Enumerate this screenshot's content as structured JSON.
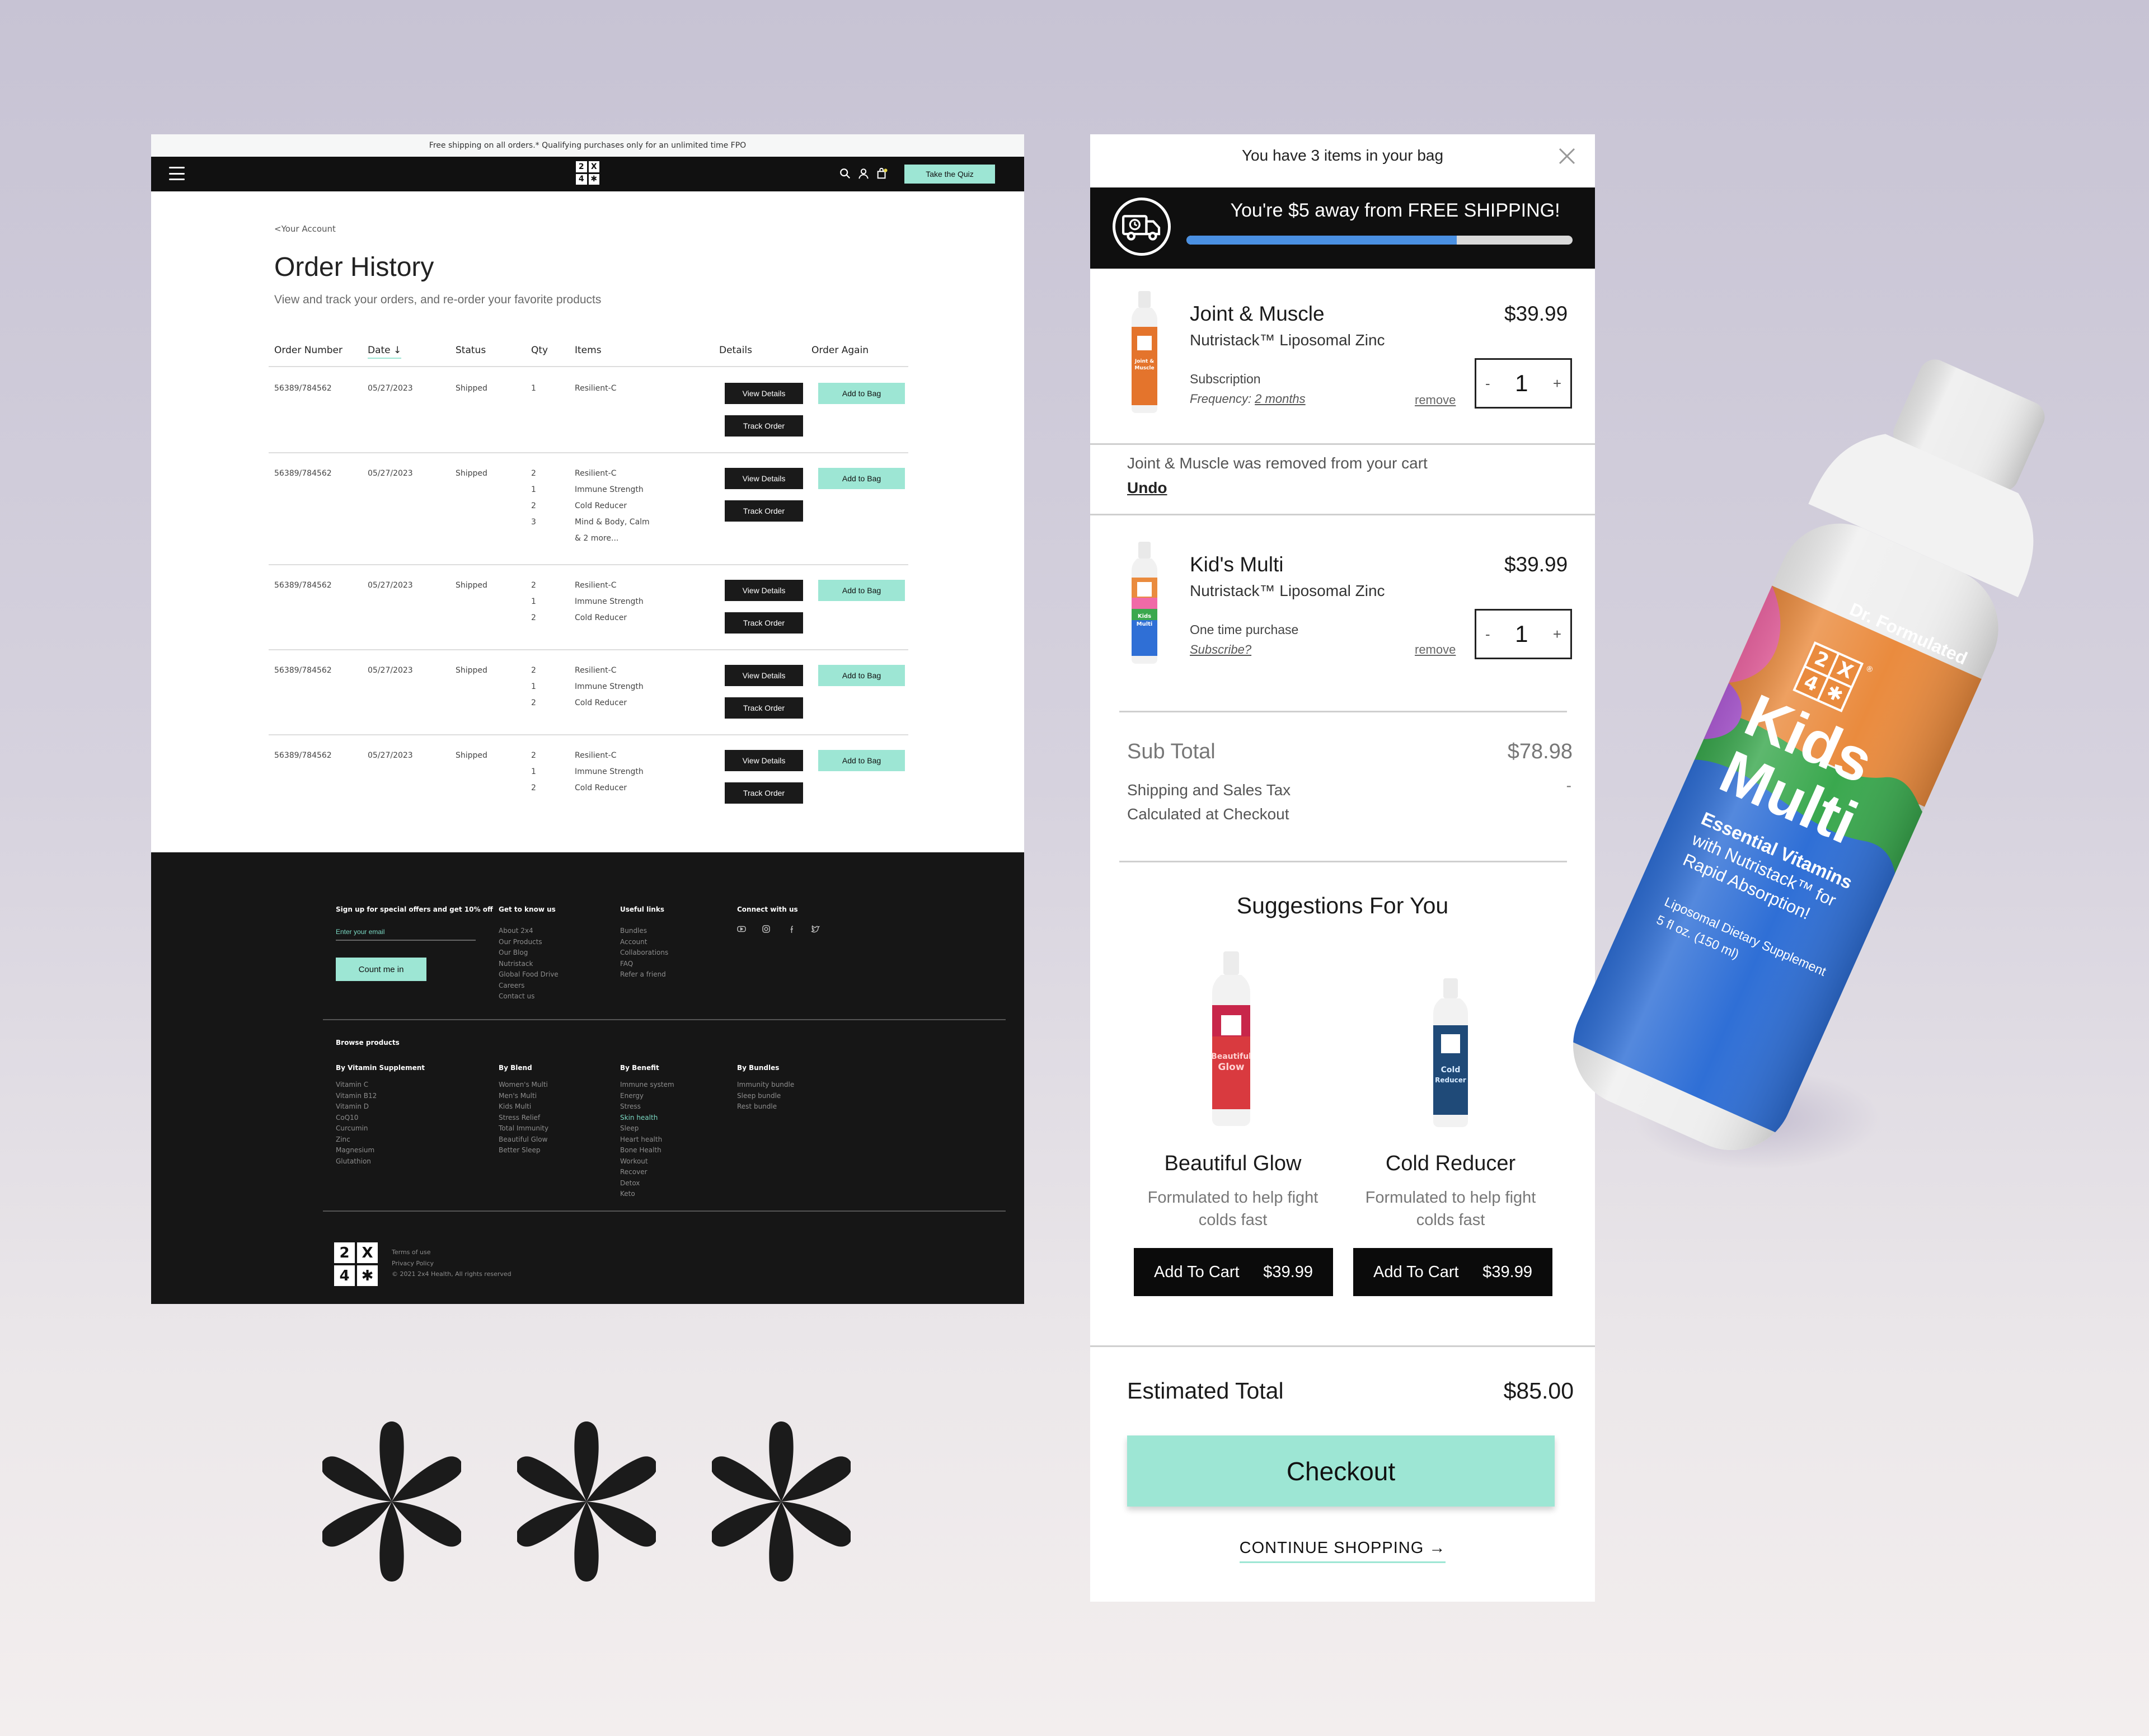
{
  "desktop": {
    "promo_text": "Free shipping on all orders.* Qualifying purchases only for an unlimited time FPO",
    "nav": {
      "quiz_button": "Take the Quiz",
      "logo": [
        "2",
        "X",
        "4",
        "✱"
      ]
    },
    "breadcrumb": "<Your Account",
    "title": "Order History",
    "subtitle": "View and track your orders, and re-order your favorite products",
    "columns": [
      "Order Number",
      "Date",
      "Status",
      "Qty",
      "Items",
      "Details",
      "Order Again"
    ],
    "date_sort_arrow": "↓",
    "buttons": {
      "view_details": "View Details",
      "track_order": "Track Order",
      "add_to_bag": "Add to Bag"
    },
    "orders": [
      {
        "number": "56389/784562",
        "date": "05/27/2023",
        "status": "Shipped",
        "qty": [
          "1"
        ],
        "items": [
          "Resilient-C"
        ]
      },
      {
        "number": "56389/784562",
        "date": "05/27/2023",
        "status": "Shipped",
        "qty": [
          "2",
          "1",
          "2",
          "3"
        ],
        "items": [
          "Resilient-C",
          "Immune Strength",
          "Cold Reducer",
          "Mind & Body, Calm",
          "& 2 more..."
        ]
      },
      {
        "number": "56389/784562",
        "date": "05/27/2023",
        "status": "Shipped",
        "qty": [
          "2",
          "1",
          "2"
        ],
        "items": [
          "Resilient-C",
          "Immune Strength",
          "Cold Reducer"
        ]
      },
      {
        "number": "56389/784562",
        "date": "05/27/2023",
        "status": "Shipped",
        "qty": [
          "2",
          "1",
          "2"
        ],
        "items": [
          "Resilient-C",
          "Immune Strength",
          "Cold Reducer"
        ]
      },
      {
        "number": "56389/784562",
        "date": "05/27/2023",
        "status": "Shipped",
        "qty": [
          "2",
          "1",
          "2"
        ],
        "items": [
          "Resilient-C",
          "Immune Strength",
          "Cold Reducer"
        ]
      }
    ],
    "footer": {
      "signup_heading": "Sign up for special offers and get 10% off",
      "email_placeholder": "Enter your email",
      "signup_button": "Count me in",
      "cols": [
        {
          "title": "Get to know us",
          "links": [
            "About 2x4",
            "Our Products",
            "Our Blog",
            "Nutristack",
            "Global Food Drive",
            "Careers",
            "Contact us"
          ]
        },
        {
          "title": "Useful links",
          "links": [
            "Bundles",
            "Account",
            "Collaborations",
            "FAQ",
            "Refer a friend"
          ]
        },
        {
          "title": "Connect with us",
          "links": []
        }
      ],
      "browse_heading": "Browse products",
      "browse_cols": [
        {
          "title": "By Vitamin Supplement",
          "links": [
            "Vitamin C",
            "Vitamin B12",
            "Vitamin D",
            "CoQ10",
            "Curcumin",
            "Zinc",
            "Magnesium",
            "Glutathion"
          ]
        },
        {
          "title": "By Blend",
          "links": [
            "Women's Multi",
            "Men's Multi",
            "Kids Multi",
            "Stress Relief",
            "Total Immunity",
            "Beautiful Glow",
            "Better Sleep"
          ]
        },
        {
          "title": "By Benefit",
          "links": [
            "Immune system",
            "Energy",
            "Stress",
            "Skin health",
            "Sleep",
            "Heart health",
            "Bone Health",
            "Workout",
            "Recover",
            "Detox",
            "Keto"
          ]
        },
        {
          "title": "By Bundles",
          "links": [
            "Immunity bundle",
            "Sleep bundle",
            "Rest bundle"
          ]
        }
      ],
      "legal": [
        "Terms of use",
        "Privacy Policy",
        "© 2021 2x4 Health, All rights reserved"
      ],
      "social_icons": [
        "youtube-icon",
        "instagram-icon",
        "facebook-icon",
        "twitter-icon"
      ]
    }
  },
  "cart": {
    "count_text": "You have 3 items in your bag",
    "shipping_banner": "You're $5 away from FREE SHIPPING!",
    "shipping_progress": 0.7,
    "items": [
      {
        "name": "Joint & Muscle",
        "sub": "Nutristack™ Liposomal Zinc",
        "price": "$39.99",
        "purchase_type": "Subscription",
        "frequency_label": "Frequency: ",
        "frequency_value": "2 months",
        "remove": "remove",
        "qty": "1",
        "minus": "-",
        "plus": "+",
        "bottle_label": "Joint & Muscle"
      },
      {
        "name": "Kid's Multi",
        "sub": "Nutristack™ Liposomal Zinc",
        "price": "$39.99",
        "purchase_type": "One time purchase",
        "subscribe_link": "Subscribe?",
        "remove": "remove",
        "qty": "1",
        "minus": "-",
        "plus": "+",
        "bottle_label": "Kids Multi"
      }
    ],
    "removed_message": "Joint & Muscle was removed from your cart",
    "undo": "Undo",
    "subtotal_label": "Sub Total",
    "subtotal_value": "$78.98",
    "shipping_label_1": "Shipping and Sales Tax",
    "shipping_label_2": "Calculated at Checkout",
    "shipping_value": "-",
    "suggestions_title": "Suggestions For You",
    "suggestions": [
      {
        "name": "Beautiful Glow",
        "desc_1": "Formulated to help fight",
        "desc_2": "colds fast",
        "button": "Add To Cart",
        "price": "$39.99",
        "label_1": "Beautiful",
        "label_2": "Glow"
      },
      {
        "name": "Cold Reducer",
        "desc_1": "Formulated to help fight",
        "desc_2": "colds fast",
        "button": "Add To Cart",
        "price": "$39.99",
        "label_1": "Cold",
        "label_2": "Reducer"
      }
    ],
    "estimated_label": "Estimated Total",
    "estimated_value": "$85.00",
    "checkout_button": "Checkout",
    "continue_shopping": "CONTINUE SHOPPING →"
  },
  "bottle": {
    "brand": "Dr. Formulated",
    "name_1": "Kids",
    "name_2": "Multi",
    "tag_1": "Essential Vitamins",
    "tag_2": "with Nutristack™ for",
    "tag_3": "Rapid Absorption!",
    "detail_1": "Liposomal Dietary Supplement",
    "detail_2": "5 fl oz. (150 ml)",
    "logo": [
      "2",
      "X",
      "4",
      "✱"
    ],
    "registered": "®"
  },
  "colors": {
    "mint": "#9de6d4",
    "black": "#111111",
    "progress_blue": "#4a90e2",
    "bottle_orange": "#ea8b3e",
    "bottle_blue": "#2f6fd6",
    "bottle_green": "#3aa84e",
    "bottle_pink": "#f06aa7"
  }
}
